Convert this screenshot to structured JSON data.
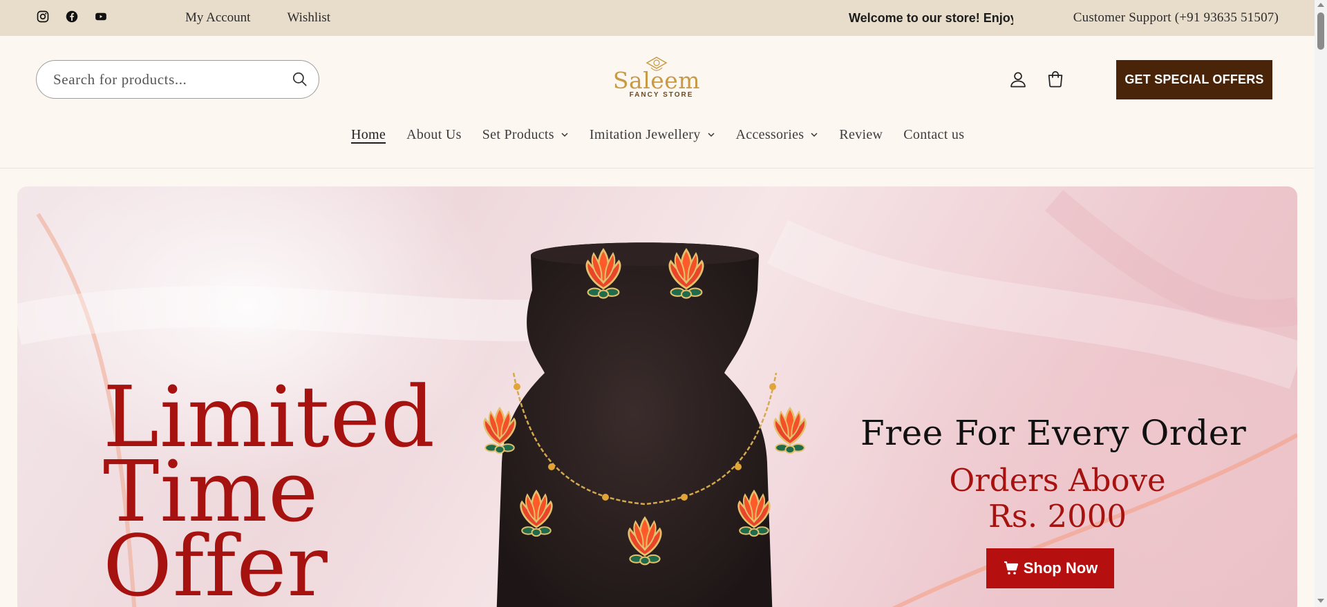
{
  "topbar": {
    "social": [
      "instagram-icon",
      "facebook-icon",
      "youtube-icon"
    ],
    "links": [
      "My Account",
      "Wishlist"
    ],
    "marquee": "Welcome to our store! Enjoy",
    "support": "Customer Support (+91 93635 51507)"
  },
  "header": {
    "search_placeholder": "Search for products...",
    "logo_word": "Saleem",
    "logo_sub": "FANCY STORE",
    "cta_label": "GET SPECIAL OFFERS"
  },
  "nav": {
    "items": [
      {
        "label": "Home",
        "dropdown": false,
        "active": true
      },
      {
        "label": "About Us",
        "dropdown": false
      },
      {
        "label": "Set Products",
        "dropdown": true
      },
      {
        "label": "Imitation Jewellery",
        "dropdown": true
      },
      {
        "label": "Accessories",
        "dropdown": true
      },
      {
        "label": "Review",
        "dropdown": false
      },
      {
        "label": "Contact us",
        "dropdown": false
      }
    ]
  },
  "hero": {
    "headline": [
      "Limited",
      "Time",
      "Offer"
    ],
    "promo_line1": "Free For Every Order",
    "promo_line2": "Orders Above",
    "promo_line3": "Rs. 2000",
    "shop_label": "Shop Now"
  },
  "colors": {
    "topbar": "#e8dccb",
    "cta": "#4a2408",
    "accent_red": "#a6120f",
    "shop_button": "#b50f0f"
  }
}
